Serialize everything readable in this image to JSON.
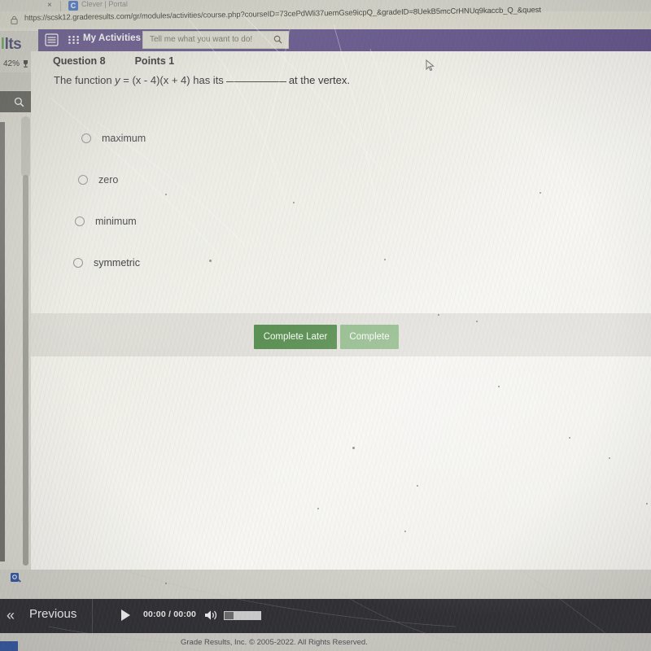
{
  "browser": {
    "tab": {
      "close_label": "×",
      "favicon_letter": "C",
      "title": "Clever | Portal"
    },
    "url": "https://scsk12.graderesults.com/gr/modules/activities/course.php?courseID=73cePdWli37uemGse9icpQ_&gradeID=8UekB5mcCrHNUq9kaccb_Q_&quest",
    "lock_icon": "lock-icon"
  },
  "appbar": {
    "grid_icon": "app-grid-icon",
    "menu_icon": "list-menu-icon",
    "my_activities": "My Activities",
    "search_placeholder": "Tell me what you want to do!",
    "search_icon": "search-icon",
    "accent_purple": "#5e4c8e"
  },
  "rail": {
    "brand": "lts",
    "progress_percent": "42%",
    "trophy_icon": "trophy-icon",
    "search_icon": "search-icon",
    "accessibility_icon": "accessibility-icon"
  },
  "question": {
    "number_label": "Question 8",
    "points_label": "Points 1",
    "prompt_prefix": "The function ",
    "prompt_math_y": "y",
    "prompt_math_rest": " = (x - 4)(x + 4) has its",
    "prompt_suffix": "at the vertex.",
    "options": [
      {
        "label": "maximum",
        "selected": false
      },
      {
        "label": "zero",
        "selected": false
      },
      {
        "label": "minimum",
        "selected": false
      },
      {
        "label": "symmetric",
        "selected": false
      }
    ],
    "buttons": {
      "complete_later": "Complete Later",
      "complete": "Complete",
      "complete_later_color": "#4c8c42",
      "complete_color": "#8fbe86"
    }
  },
  "player": {
    "prev_chevron": "«",
    "prev_label": "Previous",
    "play_icon": "play-icon",
    "time_current": "00:00",
    "time_separator": "/",
    "time_total": "00:00",
    "volume_icon": "volume-icon"
  },
  "footer": {
    "copyright": "Grade Results, Inc. © 2005-2022. All Rights Reserved."
  },
  "cursor": {
    "icon": "mouse-pointer-icon"
  }
}
